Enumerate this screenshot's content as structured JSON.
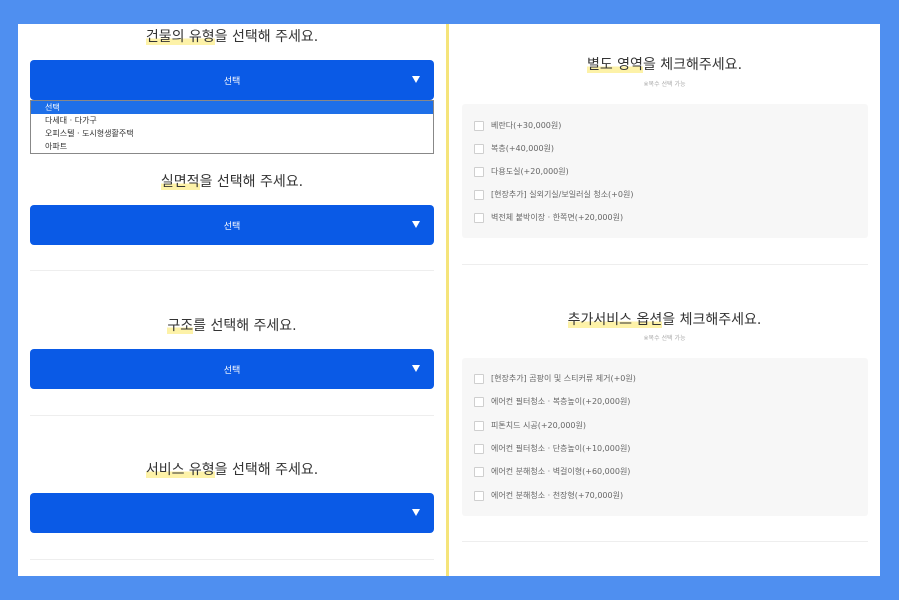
{
  "left": {
    "questions": [
      {
        "title_hl": "건물의 유형",
        "title_rest": "을 선택해 주세요.",
        "select_label": "선택"
      },
      {
        "title_hl": "실면적",
        "title_rest": "을 선택해 주세요.",
        "select_label": "선택"
      },
      {
        "title_hl": "구조",
        "title_rest": "를 선택해 주세요.",
        "select_label": "선택"
      },
      {
        "title_hl": "서비스 유형",
        "title_rest": "을 선택해 주세요.",
        "select_label": ""
      }
    ],
    "dropdown_options": [
      "선택",
      "다세대 · 다가구",
      "오피스텔 · 도시형생활주택",
      "아파트"
    ]
  },
  "right": {
    "sections": [
      {
        "title_hl": "별도 영역",
        "title_rest": "을 체크해주세요.",
        "subtitle": "※복수 선택 가능",
        "options": [
          "베란다(+30,000원)",
          "복층(+40,000원)",
          "다용도실(+20,000원)",
          "[현장추가] 실외기실/보일러실 청소(+0원)",
          "벽전체 붙박이장 · 한쪽면(+20,000원)"
        ]
      },
      {
        "title_hl": "추가서비스 옵션",
        "title_rest": "을 체크해주세요.",
        "subtitle": "※복수 선택 가능",
        "options": [
          "[현장추가] 곰팡이 및 스티커류 제거(+0원)",
          "에어컨 필터청소 · 복층높이(+20,000원)",
          "피톤치드 시공(+20,000원)",
          "에어컨 필터청소 · 단층높이(+10,000원)",
          "에어컨 분해청소 · 벽걸이형(+60,000원)",
          "에어컨 분해청소 · 천장형(+70,000원)"
        ]
      }
    ]
  },
  "colors": {
    "background": "#4f8ff0",
    "select_button": "#0a5ae6",
    "highlight": "#fdf2a8",
    "divider": "#f5e47a"
  }
}
